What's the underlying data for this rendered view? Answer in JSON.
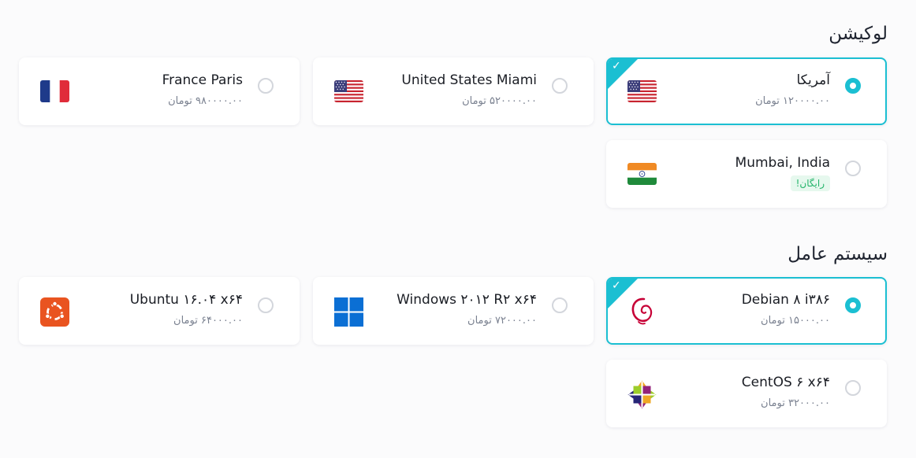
{
  "location": {
    "title": "لوکیشن",
    "options": [
      {
        "name": "آمریکا",
        "price": "۱۲۰۰۰۰.۰۰ تومان",
        "flag": "us-flag-icon",
        "selected": true
      },
      {
        "name": "United States Miami",
        "price": "۵۲۰۰۰۰.۰۰ تومان",
        "flag": "us-flag-icon",
        "selected": false
      },
      {
        "name": "France Paris",
        "price": "۹۸۰۰۰۰.۰۰ تومان",
        "flag": "fr-flag-icon",
        "selected": false
      },
      {
        "name": "Mumbai, India",
        "badge": "رایگان!",
        "flag": "in-flag-icon",
        "selected": false
      }
    ]
  },
  "os": {
    "title": "سیستم عامل",
    "options": [
      {
        "name": "Debian ۸ i۳۸۶",
        "price": "۱۵۰۰۰.۰۰ تومان",
        "logo": "debian-logo-icon",
        "selected": true
      },
      {
        "name": "Windows ۲۰۱۲ R۲ x۶۴",
        "price": "۷۲۰۰۰.۰۰ تومان",
        "logo": "windows-logo-icon",
        "selected": false
      },
      {
        "name": "Ubuntu ۱۶.۰۴ x۶۴",
        "price": "۶۴۰۰۰.۰۰ تومان",
        "logo": "ubuntu-logo-icon",
        "selected": false
      },
      {
        "name": "CentOS ۶ x۶۴",
        "price": "۳۲۰۰۰.۰۰ تومان",
        "logo": "centos-logo-icon",
        "selected": false
      }
    ]
  },
  "colors": {
    "accent": "#1bbfd2",
    "free_badge": "#23b46a"
  },
  "icons": {
    "selected_check": "✓"
  }
}
